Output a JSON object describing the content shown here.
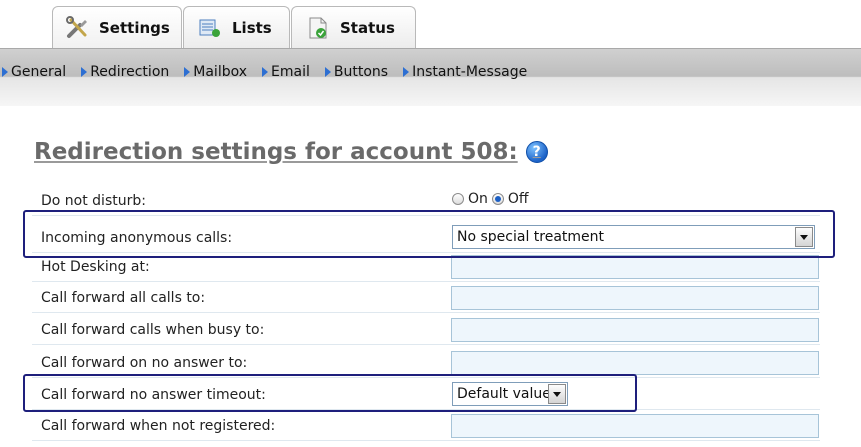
{
  "tabs": [
    {
      "label": "Settings",
      "icon": "tools-icon",
      "active": true
    },
    {
      "label": "Lists",
      "icon": "list-icon",
      "active": false
    },
    {
      "label": "Status",
      "icon": "status-icon",
      "active": false
    }
  ],
  "subnav": [
    "General",
    "Redirection",
    "Mailbox",
    "Email",
    "Buttons",
    "Instant-Message"
  ],
  "heading": {
    "title": "Redirection settings for account 508:",
    "help_icon": "help-icon",
    "help_glyph": "?"
  },
  "form": {
    "dnd": {
      "label": "Do not disturb:",
      "on_label": "On",
      "off_label": "Off",
      "selected": "Off"
    },
    "anon": {
      "label": "Incoming anonymous calls:",
      "value": "No special treatment"
    },
    "hot": {
      "label": "Hot Desking at:",
      "value": ""
    },
    "all": {
      "label": "Call forward all calls to:",
      "value": ""
    },
    "busy": {
      "label": "Call forward calls when busy to:",
      "value": ""
    },
    "noans": {
      "label": "Call forward on no answer to:",
      "value": ""
    },
    "timeout": {
      "label": "Call forward no answer timeout:",
      "value": "Default value"
    },
    "notreg": {
      "label": "Call forward when not registered:",
      "value": ""
    }
  },
  "colors": {
    "highlight_border": "#1e1f7c",
    "nav_arrow": "#2d6fd2",
    "field_bg": "#eef6fc"
  }
}
